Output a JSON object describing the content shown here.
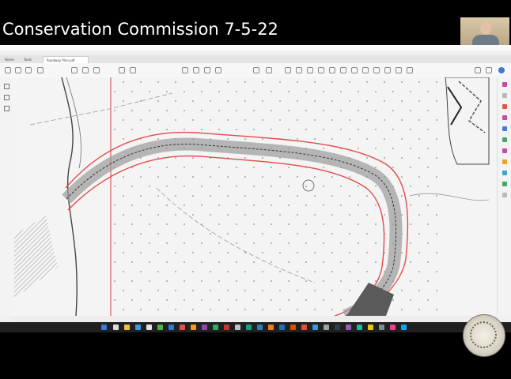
{
  "meeting_title": "Conservation Commission 7-5-22",
  "viewer": {
    "tabs": [
      {
        "label": "Home"
      },
      {
        "label": "Tools"
      },
      {
        "label": "Roadway Plan.pdf"
      }
    ]
  }
}
